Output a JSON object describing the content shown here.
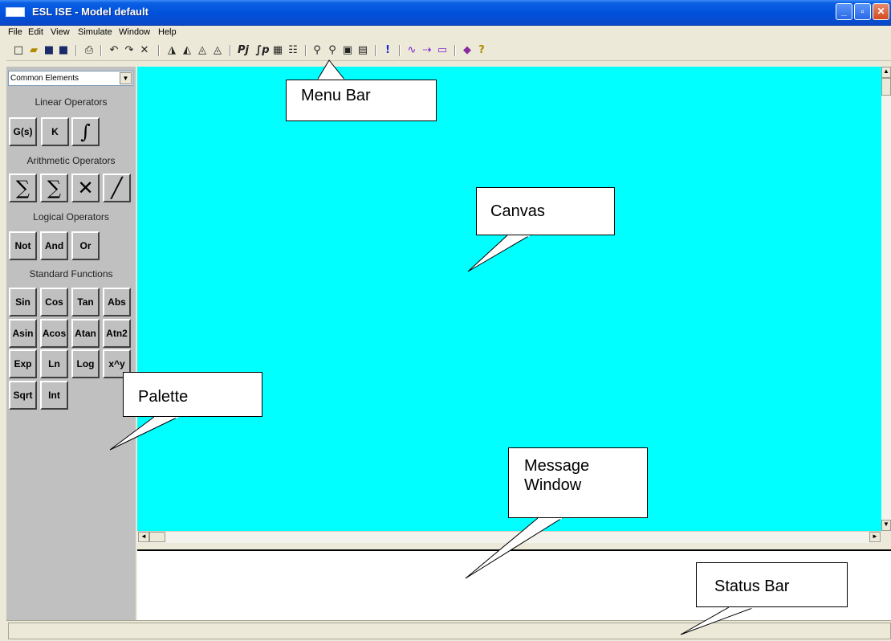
{
  "window": {
    "title": "ESL ISE - Model default"
  },
  "window_controls": {
    "minimize": "_",
    "maximize": "▫",
    "close": "✕"
  },
  "menu": {
    "items": [
      "File",
      "Edit",
      "View",
      "Simulate",
      "Window",
      "Help"
    ]
  },
  "toolbar": {
    "buttons": [
      {
        "icon": "new-file-icon",
        "glyph": "□"
      },
      {
        "icon": "open-folder-icon",
        "glyph": "▰"
      },
      {
        "icon": "save-icon",
        "glyph": "■"
      },
      {
        "icon": "save-all-icon",
        "glyph": "■"
      },
      {
        "icon": "print-icon",
        "glyph": "⎙"
      },
      {
        "icon": "undo-icon",
        "glyph": "↶"
      },
      {
        "icon": "redo-icon",
        "glyph": "↷"
      },
      {
        "icon": "delete-icon",
        "glyph": "✕"
      },
      {
        "icon": "flip-horizontal-icon",
        "glyph": "◮"
      },
      {
        "icon": "flip-vertical-icon",
        "glyph": "◭"
      },
      {
        "icon": "rotate-left-icon",
        "glyph": "◬"
      },
      {
        "icon": "rotate-right-icon",
        "glyph": "◬"
      },
      {
        "icon": "model-pi-icon",
        "glyph": "Pj"
      },
      {
        "icon": "model-integral-icon",
        "glyph": "∫p"
      },
      {
        "icon": "component-icon",
        "glyph": "▦"
      },
      {
        "icon": "properties-icon",
        "glyph": "☷"
      },
      {
        "icon": "zoom-icon",
        "glyph": "⚲"
      },
      {
        "icon": "zoom-in-icon",
        "glyph": "⚲"
      },
      {
        "icon": "zoom-fit-icon",
        "glyph": "▣"
      },
      {
        "icon": "grid-icon",
        "glyph": "▤"
      },
      {
        "icon": "run-icon",
        "glyph": "!"
      },
      {
        "icon": "plot-icon",
        "glyph": "∿"
      },
      {
        "icon": "connect-icon",
        "glyph": "⇢"
      },
      {
        "icon": "block-icon",
        "glyph": "▭"
      },
      {
        "icon": "book-icon",
        "glyph": "◆"
      },
      {
        "icon": "help-icon",
        "glyph": "?"
      }
    ]
  },
  "palette": {
    "selected": "Common Elements",
    "sections": [
      {
        "title": "Linear Operators",
        "buttons": [
          "G(s)",
          "K",
          "∫"
        ]
      },
      {
        "title": "Arithmetic Operators",
        "buttons": [
          "∑",
          "∑",
          "✕",
          "╱"
        ]
      },
      {
        "title": "Logical Operators",
        "buttons": [
          "Not",
          "And",
          "Or"
        ]
      },
      {
        "title": "Standard Functions",
        "buttons": [
          "Sin",
          "Cos",
          "Tan",
          "Abs",
          "Asin",
          "Acos",
          "Atan",
          "Atn2",
          "Exp",
          "Ln",
          "Log",
          "x^y",
          "Sqrt",
          "Int"
        ]
      }
    ]
  },
  "scrollbar": {
    "up": "▲",
    "down": "▼",
    "left": "◄",
    "right": "►"
  },
  "callouts": {
    "menu_bar": "Menu Bar",
    "canvas": "Canvas",
    "palette": "Palette",
    "message_window_line1": "Message",
    "message_window_line2": "Window",
    "status_bar": "Status Bar"
  },
  "colors": {
    "canvas": "#00ffff",
    "palette": "#c0c0c0",
    "titlebar": "#0052dc"
  }
}
